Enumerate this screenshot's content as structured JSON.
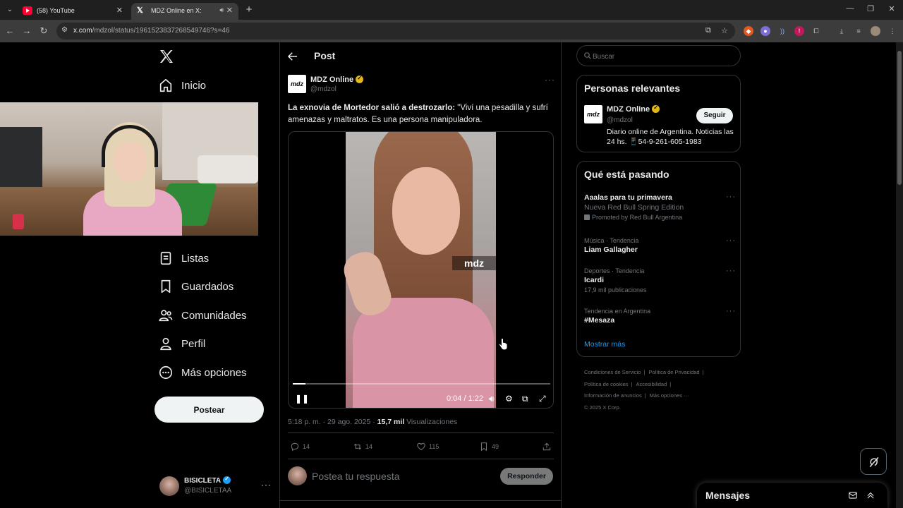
{
  "browser": {
    "tabs": [
      {
        "title": "(58) YouTube",
        "active": false
      },
      {
        "title": "MDZ Online en X: \"La exnovia",
        "active": true
      }
    ],
    "url_host": "x.com",
    "url_path": "/mdzol/status/1961523837268549746?s=46"
  },
  "sidebar": {
    "items": [
      {
        "label": "Inicio",
        "icon": "home-icon"
      },
      {
        "label": "Listas",
        "icon": "list-icon"
      },
      {
        "label": "Guardados",
        "icon": "bookmark-icon"
      },
      {
        "label": "Comunidades",
        "icon": "communities-icon"
      },
      {
        "label": "Perfil",
        "icon": "profile-icon"
      },
      {
        "label": "Más opciones",
        "icon": "more-options-icon"
      }
    ],
    "post_button": "Postear",
    "account": {
      "name": "BISICLETA",
      "handle": "@BISICLETAA"
    }
  },
  "post": {
    "header": "Post",
    "author": {
      "name": "MDZ Online",
      "handle": "@mdzol",
      "avatar_text": "mdz"
    },
    "text_bold": "La exnovia de Mortedor salió a destrozarlo:",
    "text_rest": " \"Viví una pesadilla y sufrí amenazas y maltratos. Es una persona manipuladora.",
    "video": {
      "time": "0:04 / 1:22",
      "progress": 0.05,
      "logo": "mdz"
    },
    "timestamp": "5:18 p. m. · 29 ago. 2025 · ",
    "views_count": "15,7 mil",
    "views_label": " Visualizaciones",
    "stats": {
      "replies": "14",
      "reposts": "14",
      "likes": "115",
      "bookmarks": "49"
    },
    "reply_placeholder": "Postea tu respuesta",
    "reply_button": "Responder"
  },
  "right": {
    "search_placeholder": "Buscar",
    "relevant": {
      "title": "Personas relevantes",
      "name": "MDZ Online",
      "handle": "@mdzol",
      "avatar_text": "mdz",
      "follow": "Seguir",
      "bio": "Diario online de Argentina. Noticias las 24 hs. 📱54-9-261-605-1983"
    },
    "trending": {
      "title": "Qué está pasando",
      "items": [
        {
          "name": "Aaalas para tu primavera",
          "sub": "Nueva Red Bull Spring Edition",
          "promo": "Promoted by Red Bull Argentina"
        },
        {
          "category": "Música · Tendencia",
          "name": "Liam Gallagher"
        },
        {
          "category": "Deportes · Tendencia",
          "name": "Icardi",
          "count": "17,9 mil publicaciones"
        },
        {
          "category": "Tendencia en Argentina",
          "name": "#Mesaza"
        }
      ],
      "show_more": "Mostrar más"
    },
    "footer": {
      "terms": "Condiciones de Servicio",
      "privacy": "Política de Privacidad",
      "cookies": "Política de cookies",
      "accessibility": "Accesibilidad",
      "ads": "Información de anuncios",
      "more": "Más opciones ···",
      "copyright": "© 2025 X Corp."
    },
    "messages": "Mensajes"
  }
}
